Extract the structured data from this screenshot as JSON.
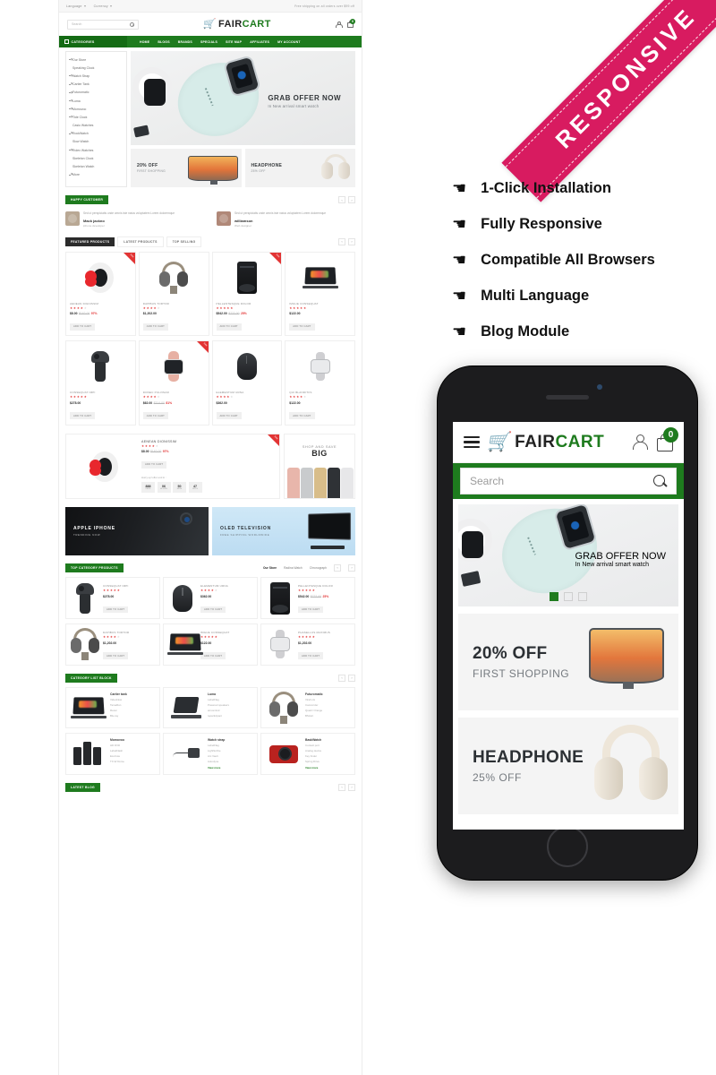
{
  "desktop": {
    "topbar": {
      "language": "Language",
      "currency": "Currency",
      "promo": "Free shipping on all orders over $99 off"
    },
    "header": {
      "search_placeholder": "Search",
      "brand_first": "FAIR",
      "brand_second": "CART",
      "cart_count": "0"
    },
    "nav": {
      "categories_label": "CATEGORIES",
      "items": [
        "HOME",
        "BLOGS",
        "BRANDS",
        "SPECIALS",
        "SITE MAP",
        "AFFILIATES",
        "MY ACCOUNT"
      ]
    },
    "sidebar": {
      "items": [
        {
          "label": "Our Store",
          "arrow": true
        },
        {
          "label": "Speaking Clock",
          "arrow": false
        },
        {
          "label": "Watch Strap",
          "arrow": true
        },
        {
          "label": "Cartier Tank",
          "arrow": true
        },
        {
          "label": "Futuromatic",
          "arrow": true
        },
        {
          "label": "Luma",
          "arrow": true
        },
        {
          "label": "Momovoo",
          "arrow": true
        },
        {
          "label": "Tide Clock",
          "arrow": true
        },
        {
          "label": "Casio Watches",
          "arrow": false
        },
        {
          "label": "RockWatch",
          "arrow": true
        },
        {
          "label": "Slow Watch",
          "arrow": false
        },
        {
          "label": "Rolex Watches",
          "arrow": true
        },
        {
          "label": "Skeleton Clock",
          "arrow": false
        },
        {
          "label": "Skeleton Watch",
          "arrow": false
        },
        {
          "label": "More",
          "arrow": true
        }
      ]
    },
    "hero": {
      "title": "GRAB OFFER NOW",
      "subtitle": "In New arrival smart watch"
    },
    "small_banners": [
      {
        "title": "20% OFF",
        "subtitle": "FIRST SHOPPING"
      },
      {
        "title": "HEADPHONE",
        "subtitle": "25% OFF"
      }
    ],
    "testimonial_section": {
      "heading": "HAPPY CUSTOMER",
      "items": [
        {
          "quote": "Sed ut perspiciatis unde omnis iste natus voluptatem Lorem doloremque",
          "name": "Mack jackno",
          "role": "iphone developer"
        },
        {
          "quote": "Sed ut perspiciatis unde omnis iste natus voluptatem Lorem doloremque",
          "name": "williamson",
          "role": "Web designer"
        }
      ]
    },
    "featured_section": {
      "tabs": [
        "FEATURED PRODUCTS",
        "LATEST PRODUCTS",
        "TOP SELLING"
      ],
      "add_to_cart": "ADD TO CART",
      "sale_label": "Sale",
      "products": [
        {
          "name": "AENEAN DIGNISSIM",
          "price": "$8.00",
          "old_price": "$162.00",
          "discount": "97%",
          "stars": 4,
          "sale": true,
          "shape": "s-band"
        },
        {
          "name": "DAPIBUS TORTOR",
          "price": "$1,202.00",
          "old_price": "",
          "discount": "",
          "stars": 4,
          "sale": false,
          "shape": "s-hp"
        },
        {
          "name": "PELLENTESQUE DOLOR",
          "price": "$542.00",
          "old_price": "$722.00",
          "discount": "25%",
          "stars": 5,
          "sale": true,
          "shape": "s-lens"
        },
        {
          "name": "IMGUE CONSEQUAT",
          "price": "$122.00",
          "old_price": "",
          "discount": "",
          "stars": 5,
          "sale": false,
          "shape": "s-lap"
        },
        {
          "name": "CONSEQUAT IMPI",
          "price": "$278.00",
          "old_price": "",
          "discount": "",
          "stars": 5,
          "sale": false,
          "shape": "s-shav"
        },
        {
          "name": "DONEC PULVINAR",
          "price": "$62.00",
          "old_price": "$314.00",
          "discount": "81%",
          "stars": 4,
          "sale": true,
          "shape": "s-watch"
        },
        {
          "name": "ELEMENTUM URNA",
          "price": "$362.00",
          "old_price": "",
          "discount": "",
          "stars": 4,
          "sale": false,
          "shape": "s-mouse"
        },
        {
          "name": "QUI BLANDITIIS",
          "price": "$122.00",
          "old_price": "",
          "discount": "",
          "stars": 4,
          "sale": false,
          "shape": "s-watch2"
        }
      ]
    },
    "deal": {
      "name": "AENEAN DIONISSIM",
      "price": "$8.00",
      "old_price": "$162.00",
      "discount": "97%",
      "stars": 4,
      "add_to_cart": "ADD TO CART",
      "hurry": "Hurry up! offer end in :",
      "countdown": [
        {
          "value": "888",
          "unit": "DAYS"
        },
        {
          "value": "06",
          "unit": "HOURS"
        },
        {
          "value": "50",
          "unit": "MINS"
        },
        {
          "value": "47",
          "unit": "SECS"
        }
      ],
      "side_banner": {
        "line1": "SHOP AND SAVE",
        "line2": "BIG"
      }
    },
    "promo_banners": [
      {
        "title": "APPLE  IPHONE",
        "subtitle": "TRENDING NOW"
      },
      {
        "title": "OLED TELEVISION",
        "subtitle": "FREE SHIPPING WORLDWIDE"
      }
    ],
    "top_category": {
      "heading": "TOP CATEGORY PRODUCTS",
      "tabs": [
        "Our Store",
        "Radina Watch",
        "Chronograph"
      ],
      "add_to_cart": "ADD TO CART",
      "products": [
        {
          "name": "CONSEQUAT IMPI",
          "price": "$278.00",
          "old_price": "",
          "discount": "",
          "stars": 5,
          "shape": "s-shav"
        },
        {
          "name": "ELEMENTUM URNA",
          "price": "$362.00",
          "old_price": "",
          "discount": "",
          "stars": 4,
          "shape": "s-mouse"
        },
        {
          "name": "PELLENTESQUE DOLOR",
          "price": "$542.00",
          "old_price": "$722.00",
          "discount": "25%",
          "stars": 5,
          "shape": "s-lens"
        },
        {
          "name": "DAPIBUS TORTOR",
          "price": "$1,202.00",
          "old_price": "",
          "discount": "",
          "stars": 4,
          "shape": "s-hp"
        },
        {
          "name": "IMGUE CONSEQUAT",
          "price": "$122.00",
          "old_price": "",
          "discount": "",
          "stars": 5,
          "shape": "s-lap"
        },
        {
          "name": "PHASELLUS MAXIMUS",
          "price": "$1,202.00",
          "old_price": "",
          "discount": "",
          "stars": 5,
          "shape": "s-watch2"
        }
      ]
    },
    "category_list": {
      "heading": "CATEGORY LIST BLOCK",
      "view_more": "View more",
      "cards": [
        {
          "title": "Cartier tank",
          "links": [
            "VideoNow",
            "TamaRun",
            "Rexar",
            "Blu-ray"
          ],
          "shape": "s-lap",
          "more": false
        },
        {
          "title": "Luma",
          "links": [
            "LabelFlag",
            "Powered speakers",
            "amosmind",
            "reparticipant"
          ],
          "shape": "s-tab",
          "more": false
        },
        {
          "title": "Futuromatic",
          "links": [
            "Viral Litx",
            "Camcorder",
            "Quartz Orange",
            "BStrart"
          ],
          "shape": "s-hp",
          "more": false
        },
        {
          "title": "Momovoo",
          "links": [
            "HD DVD",
            "LabelFlash",
            "EcoCute",
            "TX-W Dome"
          ],
          "shape": "s-spk",
          "more": false
        },
        {
          "title": "Watch strap",
          "links": [
            "LabelFlag",
            "LightScribe",
            "Arc Vault",
            "Autodyne"
          ],
          "shape": "s-chg",
          "more": true
        },
        {
          "title": "BaskWatch",
          "links": [
            "Contact port",
            "Analog device",
            "Key finder",
            "Spring Drive"
          ],
          "shape": "s-cam",
          "more": true
        }
      ]
    },
    "latest_blog": {
      "heading": "LATEST BLOG"
    }
  },
  "right_panel": {
    "ribbon": "RESPONSIVE",
    "ribbon_color": "#d81b60",
    "features": [
      "1-Click Installation",
      "Fully Responsive",
      "Compatible All Browsers",
      "Multi Language",
      "Blog Module"
    ]
  },
  "mobile": {
    "header": {
      "brand_first": "FAIR",
      "brand_second": "CART",
      "cart_count": "0"
    },
    "search_placeholder": "Search",
    "hero": {
      "title": "GRAB OFFER NOW",
      "subtitle": "In New arrival smart watch"
    },
    "banners": [
      {
        "title": "20% OFF",
        "subtitle": "FIRST SHOPPING"
      },
      {
        "title": "HEADPHONE",
        "subtitle": "25% OFF"
      }
    ]
  }
}
